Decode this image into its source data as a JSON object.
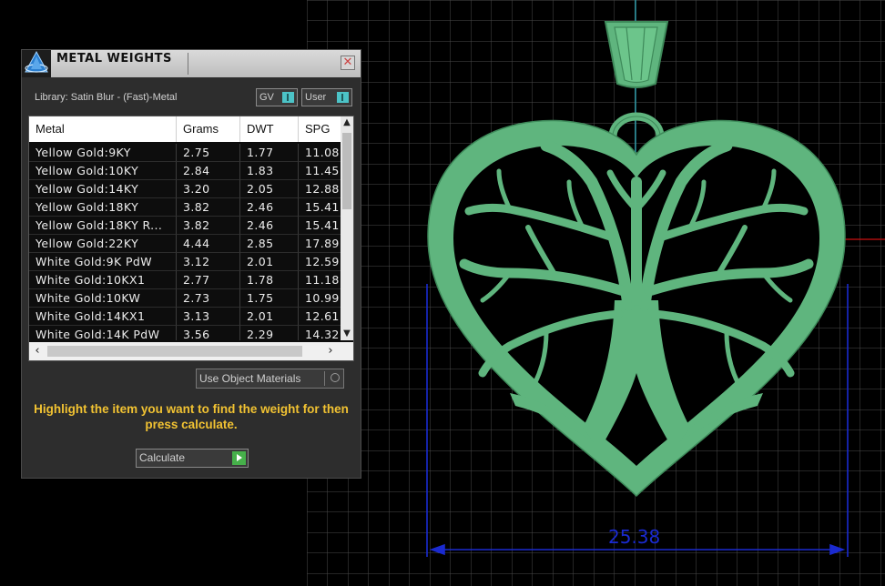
{
  "panel": {
    "title": "METAL WEIGHTS",
    "close_glyph": "✕",
    "library_label": "Library: Satin Blur - (Fast)-Metal",
    "toggle_gv": "GV",
    "toggle_user": "User",
    "use_object_materials": "Use Object Materials",
    "instruction": "Highlight the item you want to find the weight for then press calculate.",
    "calculate": "Calculate"
  },
  "table": {
    "columns": [
      "Metal",
      "Grams",
      "DWT",
      "SPG"
    ],
    "rows": [
      [
        "Yellow Gold:9KY",
        "2.75",
        "1.77",
        "11.08"
      ],
      [
        "Yellow Gold:10KY",
        "2.84",
        "1.83",
        "11.45"
      ],
      [
        "Yellow Gold:14KY",
        "3.20",
        "2.05",
        "12.88"
      ],
      [
        "Yellow Gold:18KY",
        "3.82",
        "2.46",
        "15.41"
      ],
      [
        "Yellow Gold:18KY R...",
        "3.82",
        "2.46",
        "15.41"
      ],
      [
        "Yellow Gold:22KY",
        "4.44",
        "2.85",
        "17.89"
      ],
      [
        "White Gold:9K PdW",
        "3.12",
        "2.01",
        "12.59"
      ],
      [
        "White Gold:10KX1",
        "2.77",
        "1.78",
        "11.18"
      ],
      [
        "White Gold:10KW",
        "2.73",
        "1.75",
        "10.99"
      ],
      [
        "White Gold:14KX1",
        "3.13",
        "2.01",
        "12.61"
      ],
      [
        "White Gold:14K PdW",
        "3.56",
        "2.29",
        "14.32"
      ]
    ]
  },
  "viewport": {
    "dimension_value": "25.38",
    "model_color": "#5fb57e",
    "grid_color": "#4a4a4a",
    "dimension_color": "#1a2ad0",
    "axis_color": "#cc1111"
  }
}
